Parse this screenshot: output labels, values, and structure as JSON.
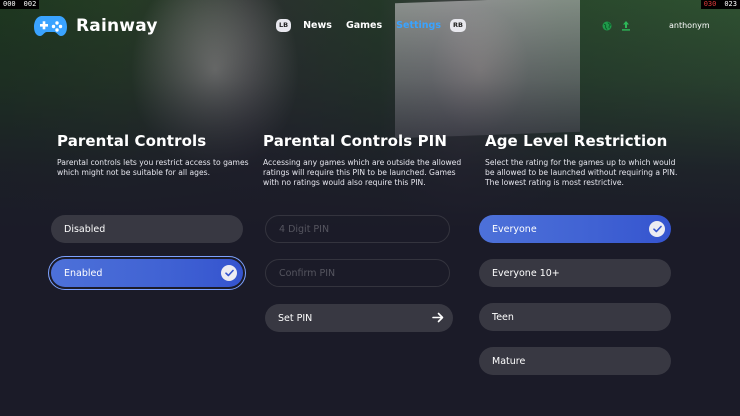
{
  "counters": {
    "left": [
      "000",
      "002"
    ],
    "right": [
      "030",
      "023"
    ]
  },
  "brand": {
    "name": "Rainway",
    "logo_icon": "gamepad-icon",
    "accent": "#3aa3ff"
  },
  "nav": {
    "left_badge": "LB",
    "right_badge": "RB",
    "items": [
      {
        "label": "News",
        "active": false
      },
      {
        "label": "Games",
        "active": false
      },
      {
        "label": "Settings",
        "active": true
      }
    ]
  },
  "status": {
    "icons": [
      "globe-icon",
      "upload-icon"
    ],
    "username": "anthonym"
  },
  "parental_controls": {
    "title": "Parental Controls",
    "description": "Parental controls lets you restrict access to games which might not be suitable for all ages.",
    "options": [
      {
        "label": "Disabled",
        "selected": false
      },
      {
        "label": "Enabled",
        "selected": true
      }
    ]
  },
  "pin": {
    "title": "Parental Controls PIN",
    "description": "Accessing any games which are outside the allowed ratings will require this PIN to be launched. Games with no ratings would also require this PIN.",
    "pin_placeholder": "4 Digit PIN",
    "confirm_placeholder": "Confirm PIN",
    "set_label": "Set PIN"
  },
  "age_restriction": {
    "title": "Age Level Restriction",
    "description": "Select the rating for the games up to which would be allowed to be launched without requiring a PIN. The lowest rating is most restrictive.",
    "options": [
      {
        "label": "Everyone",
        "selected": true
      },
      {
        "label": "Everyone 10+",
        "selected": false
      },
      {
        "label": "Teen",
        "selected": false
      },
      {
        "label": "Mature",
        "selected": false
      }
    ]
  },
  "colors": {
    "selected_gradient_start": "#4d71d9",
    "button_bg": "#383842",
    "page_bg": "#1b1b28"
  }
}
